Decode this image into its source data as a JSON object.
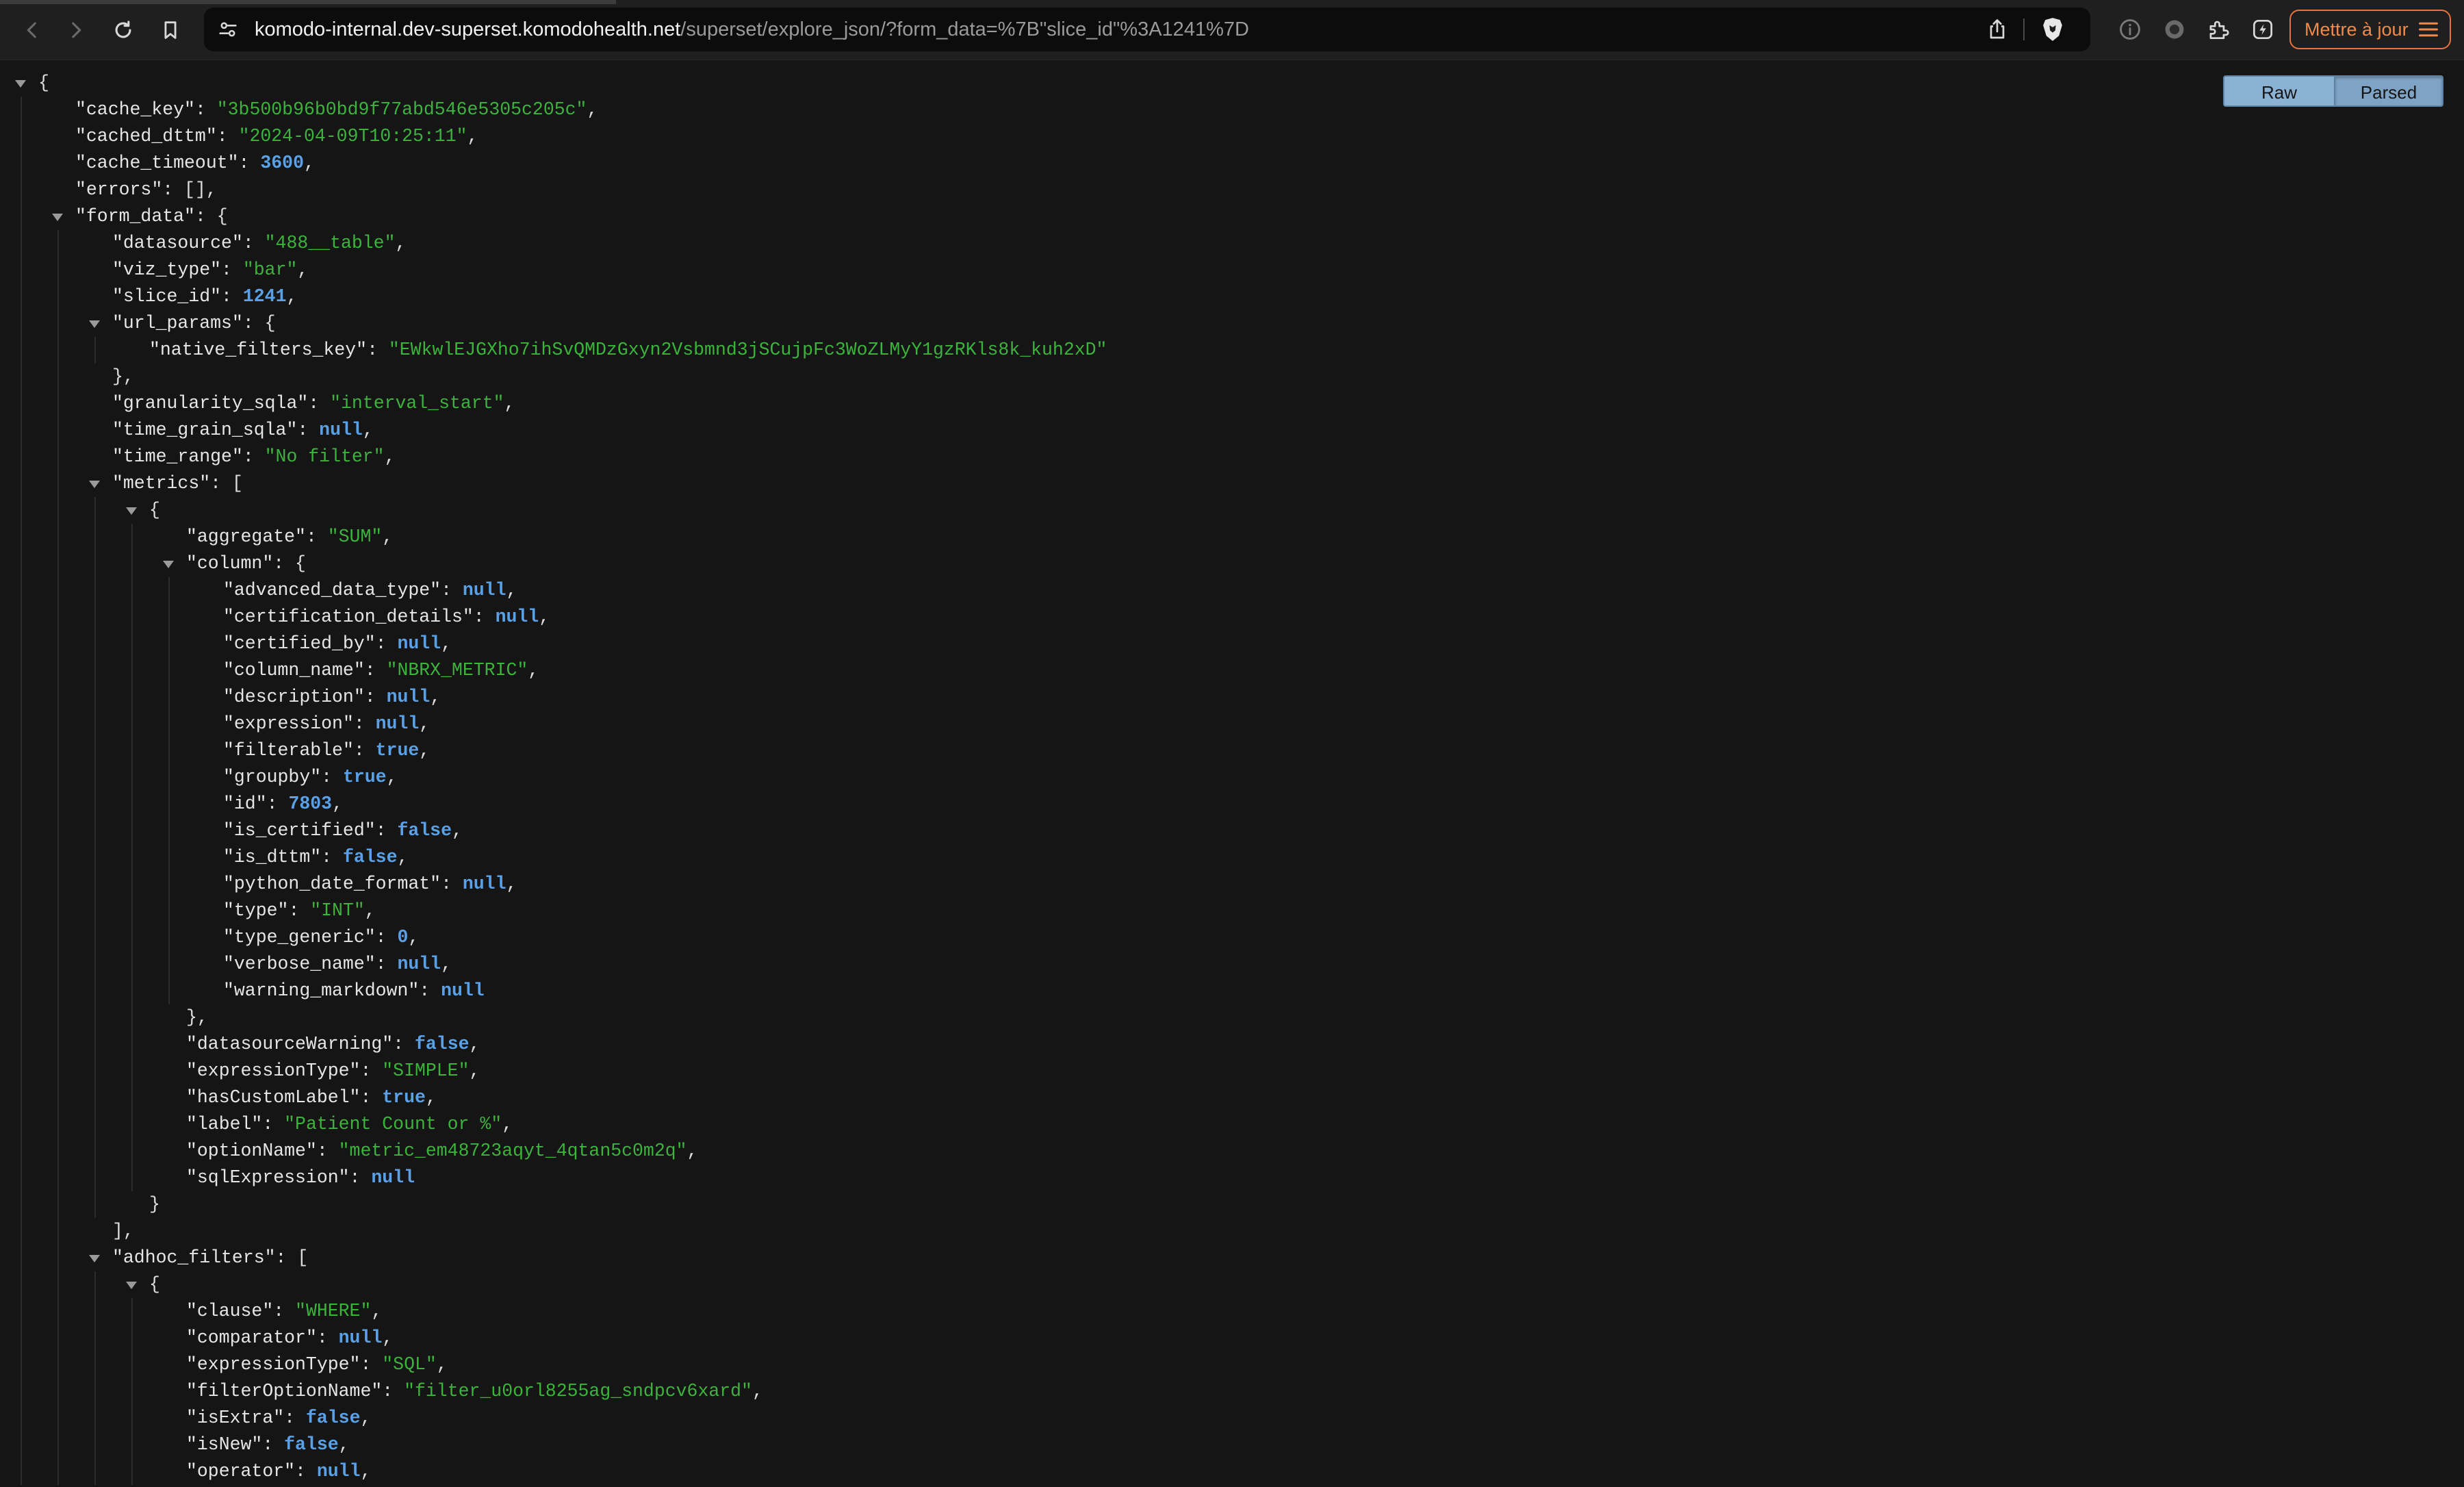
{
  "browser": {
    "url_host": "komodo-internal.dev-superset.komodohealth.net",
    "url_path": "/superset/explore_json/?form_data=%7B\"slice_id\"%3A1241%7D",
    "update_button_label": "Mettre à jour",
    "icons": [
      "back-icon",
      "forward-icon",
      "reload-icon",
      "bookmark-icon",
      "site-settings-icon",
      "share-icon",
      "brave-shield-icon",
      "info-icon",
      "record-icon",
      "extensions-icon",
      "leo-ai-icon",
      "menu-icon"
    ]
  },
  "viewer": {
    "raw_label": "Raw",
    "parsed_label": "Parsed",
    "active_view": "Parsed"
  },
  "json_lines": [
    {
      "i": 0,
      "tw": true,
      "pre": "{"
    },
    {
      "i": 1,
      "k": "cache_key",
      "v": "\"3b500b96b0bd9f77abd546e5305c205c\"",
      "t": "s",
      "c": ","
    },
    {
      "i": 1,
      "k": "cached_dttm",
      "v": "\"2024-04-09T10:25:11\"",
      "t": "s",
      "c": ","
    },
    {
      "i": 1,
      "k": "cache_timeout",
      "v": "3600",
      "t": "n",
      "c": ","
    },
    {
      "i": 1,
      "k": "errors",
      "v": "[]",
      "t": "p",
      "c": ","
    },
    {
      "i": 1,
      "tw": true,
      "k": "form_data",
      "v": "{",
      "t": "p"
    },
    {
      "i": 2,
      "k": "datasource",
      "v": "\"488__table\"",
      "t": "s",
      "c": ","
    },
    {
      "i": 2,
      "k": "viz_type",
      "v": "\"bar\"",
      "t": "s",
      "c": ","
    },
    {
      "i": 2,
      "k": "slice_id",
      "v": "1241",
      "t": "n",
      "c": ","
    },
    {
      "i": 2,
      "tw": true,
      "k": "url_params",
      "v": "{",
      "t": "p"
    },
    {
      "i": 3,
      "k": "native_filters_key",
      "v": "\"EWkwlEJGXho7ihSvQMDzGxyn2Vsbmnd3jSCujpFc3WoZLMyY1gzRKls8k_kuh2xD\"",
      "t": "s"
    },
    {
      "i": 2,
      "pre": "},"
    },
    {
      "i": 2,
      "k": "granularity_sqla",
      "v": "\"interval_start\"",
      "t": "s",
      "c": ","
    },
    {
      "i": 2,
      "k": "time_grain_sqla",
      "v": "null",
      "t": "b",
      "c": ","
    },
    {
      "i": 2,
      "k": "time_range",
      "v": "\"No filter\"",
      "t": "s",
      "c": ","
    },
    {
      "i": 2,
      "tw": true,
      "k": "metrics",
      "v": "[",
      "t": "p"
    },
    {
      "i": 3,
      "tw": true,
      "pre": "{"
    },
    {
      "i": 4,
      "k": "aggregate",
      "v": "\"SUM\"",
      "t": "s",
      "c": ","
    },
    {
      "i": 4,
      "tw": true,
      "k": "column",
      "v": "{",
      "t": "p"
    },
    {
      "i": 5,
      "k": "advanced_data_type",
      "v": "null",
      "t": "b",
      "c": ","
    },
    {
      "i": 5,
      "k": "certification_details",
      "v": "null",
      "t": "b",
      "c": ","
    },
    {
      "i": 5,
      "k": "certified_by",
      "v": "null",
      "t": "b",
      "c": ","
    },
    {
      "i": 5,
      "k": "column_name",
      "v": "\"NBRX_METRIC\"",
      "t": "s",
      "c": ","
    },
    {
      "i": 5,
      "k": "description",
      "v": "null",
      "t": "b",
      "c": ","
    },
    {
      "i": 5,
      "k": "expression",
      "v": "null",
      "t": "b",
      "c": ","
    },
    {
      "i": 5,
      "k": "filterable",
      "v": "true",
      "t": "b",
      "c": ","
    },
    {
      "i": 5,
      "k": "groupby",
      "v": "true",
      "t": "b",
      "c": ","
    },
    {
      "i": 5,
      "k": "id",
      "v": "7803",
      "t": "n",
      "c": ","
    },
    {
      "i": 5,
      "k": "is_certified",
      "v": "false",
      "t": "b",
      "c": ","
    },
    {
      "i": 5,
      "k": "is_dttm",
      "v": "false",
      "t": "b",
      "c": ","
    },
    {
      "i": 5,
      "k": "python_date_format",
      "v": "null",
      "t": "b",
      "c": ","
    },
    {
      "i": 5,
      "k": "type",
      "v": "\"INT\"",
      "t": "s",
      "c": ","
    },
    {
      "i": 5,
      "k": "type_generic",
      "v": "0",
      "t": "n",
      "c": ","
    },
    {
      "i": 5,
      "k": "verbose_name",
      "v": "null",
      "t": "b",
      "c": ","
    },
    {
      "i": 5,
      "k": "warning_markdown",
      "v": "null",
      "t": "b"
    },
    {
      "i": 4,
      "pre": "},"
    },
    {
      "i": 4,
      "k": "datasourceWarning",
      "v": "false",
      "t": "b",
      "c": ","
    },
    {
      "i": 4,
      "k": "expressionType",
      "v": "\"SIMPLE\"",
      "t": "s",
      "c": ","
    },
    {
      "i": 4,
      "k": "hasCustomLabel",
      "v": "true",
      "t": "b",
      "c": ","
    },
    {
      "i": 4,
      "k": "label",
      "v": "\"Patient Count or %\"",
      "t": "s",
      "c": ","
    },
    {
      "i": 4,
      "k": "optionName",
      "v": "\"metric_em48723aqyt_4qtan5c0m2q\"",
      "t": "s",
      "c": ","
    },
    {
      "i": 4,
      "k": "sqlExpression",
      "v": "null",
      "t": "b"
    },
    {
      "i": 3,
      "pre": "}"
    },
    {
      "i": 2,
      "pre": "],"
    },
    {
      "i": 2,
      "tw": true,
      "k": "adhoc_filters",
      "v": "[",
      "t": "p"
    },
    {
      "i": 3,
      "tw": true,
      "pre": "{"
    },
    {
      "i": 4,
      "k": "clause",
      "v": "\"WHERE\"",
      "t": "s",
      "c": ","
    },
    {
      "i": 4,
      "k": "comparator",
      "v": "null",
      "t": "b",
      "c": ","
    },
    {
      "i": 4,
      "k": "expressionType",
      "v": "\"SQL\"",
      "t": "s",
      "c": ","
    },
    {
      "i": 4,
      "k": "filterOptionName",
      "v": "\"filter_u0orl8255ag_sndpcv6xard\"",
      "t": "s",
      "c": ","
    },
    {
      "i": 4,
      "k": "isExtra",
      "v": "false",
      "t": "b",
      "c": ","
    },
    {
      "i": 4,
      "k": "isNew",
      "v": "false",
      "t": "b",
      "c": ","
    },
    {
      "i": 4,
      "k": "operator",
      "v": "null",
      "t": "b",
      "c": ","
    }
  ]
}
